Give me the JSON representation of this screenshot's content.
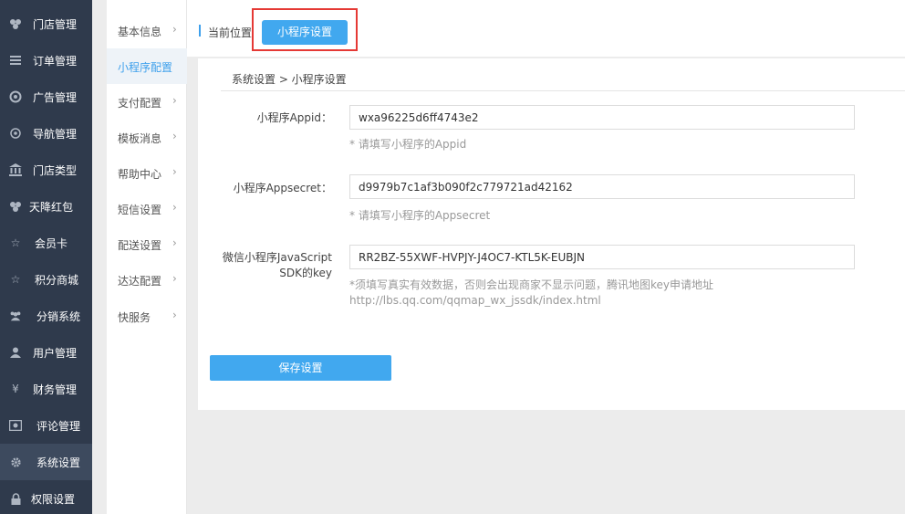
{
  "sidebar": {
    "items": [
      {
        "label": "门店管理",
        "icon": "store-icon"
      },
      {
        "label": "订单管理",
        "icon": "list-icon"
      },
      {
        "label": "广告管理",
        "icon": "ad-icon"
      },
      {
        "label": "导航管理",
        "icon": "compass-icon"
      },
      {
        "label": "门店类型",
        "icon": "bank-icon"
      },
      {
        "label": "天降红包",
        "icon": "gift-icon"
      },
      {
        "label": "会员卡",
        "icon": "star-icon"
      },
      {
        "label": "积分商城",
        "icon": "star-icon"
      },
      {
        "label": "分销系统",
        "icon": "users-icon"
      },
      {
        "label": "用户管理",
        "icon": "user-icon"
      },
      {
        "label": "财务管理",
        "icon": "yen-icon"
      },
      {
        "label": "评论管理",
        "icon": "comment-icon"
      },
      {
        "label": "系统设置",
        "icon": "gear-icon"
      },
      {
        "label": "权限设置",
        "icon": "lock-icon"
      }
    ],
    "active_index": 12
  },
  "submenu": {
    "items": [
      {
        "label": "基本信息"
      },
      {
        "label": "小程序配置"
      },
      {
        "label": "支付配置"
      },
      {
        "label": "模板消息"
      },
      {
        "label": "帮助中心"
      },
      {
        "label": "短信设置"
      },
      {
        "label": "配送设置"
      },
      {
        "label": "达达配置"
      },
      {
        "label": "快服务"
      }
    ],
    "active_index": 1,
    "chevron": "›"
  },
  "crumb": {
    "label": "当前位置",
    "button": "小程序设置"
  },
  "panel": {
    "title": "系统设置 > 小程序设置"
  },
  "form": {
    "appid": {
      "label": "小程序Appid：",
      "value": "wxa96225d6ff4743e2",
      "hint": "* 请填写小程序的Appid"
    },
    "appsecret": {
      "label": "小程序Appsecret：",
      "value": "d9979b7c1af3b090f2c779721ad42162",
      "hint": "* 请填写小程序的Appsecret"
    },
    "jssdk": {
      "label_line1": "微信小程序JavaScript",
      "label_line2": "SDK的key",
      "value": "RR2BZ-55XWF-HVPJY-J4OC7-KTL5K-EUBJN",
      "hint_line1": "*须填写真实有效数据，否则会出现商家不显示问题，腾讯地图key申请地址",
      "hint_line2": "http://lbs.qq.com/qqmap_wx_jssdk/index.html"
    },
    "save_label": "保存设置"
  },
  "colors": {
    "sidebar_bg": "#2f3a4c",
    "accent": "#41a8ef",
    "highlight": "#e53935"
  }
}
